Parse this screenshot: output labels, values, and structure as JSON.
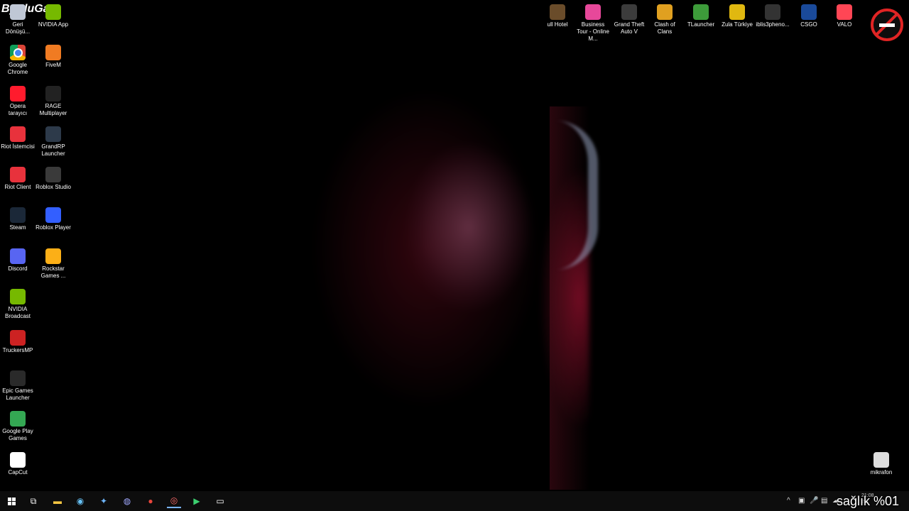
{
  "overlay": {
    "watermark": "ByBluGam",
    "status_text": "sağlık %01"
  },
  "desktop_left": [
    {
      "label": "Geri Dönüşü...",
      "icon": "recycle-bin-icon"
    },
    {
      "label": "NVIDIA App",
      "icon": "nvidia-icon"
    },
    {
      "label": "Google Chrome",
      "icon": "chrome-icon"
    },
    {
      "label": "FiveM",
      "icon": "fivem-icon"
    },
    {
      "label": "Opera tarayıcı",
      "icon": "opera-icon"
    },
    {
      "label": "RAGE Multiplayer",
      "icon": "rage-icon"
    },
    {
      "label": "Riot İstemcisi",
      "icon": "riot-icon"
    },
    {
      "label": "GrandRP Launcher",
      "icon": "grandrp-icon"
    },
    {
      "label": "Riot Client",
      "icon": "riot-client-icon"
    },
    {
      "label": "Roblox Studio",
      "icon": "roblox-studio-icon"
    },
    {
      "label": "Steam",
      "icon": "steam-icon"
    },
    {
      "label": "Roblox Player",
      "icon": "roblox-icon"
    },
    {
      "label": "Discord",
      "icon": "discord-icon"
    },
    {
      "label": "Rockstar Games ...",
      "icon": "rockstar-icon"
    },
    {
      "label": "NVIDIA Broadcast",
      "icon": "nvidia-broadcast-icon"
    },
    {
      "label": "TruckersMP",
      "icon": "truckersmp-icon"
    },
    {
      "label": "Epic Games Launcher",
      "icon": "epic-icon"
    },
    {
      "label": "Google Play Games",
      "icon": "google-play-icon"
    },
    {
      "label": "CapCut",
      "icon": "capcut-icon"
    }
  ],
  "desktop_top": [
    {
      "label": "ull Hotel",
      "icon": "hotel-icon"
    },
    {
      "label": "Business Tour - Online M...",
      "icon": "business-tour-icon"
    },
    {
      "label": "Grand Theft Auto V",
      "icon": "gta-icon"
    },
    {
      "label": "Clash of Clans",
      "icon": "clash-icon"
    },
    {
      "label": "TLauncher",
      "icon": "tlauncher-icon"
    },
    {
      "label": "Zula Türkiye",
      "icon": "zula-icon"
    },
    {
      "label": "iblis3pheno...",
      "icon": "iblis-icon"
    },
    {
      "label": "CSGO",
      "icon": "csgo-icon"
    },
    {
      "label": "VALO",
      "icon": "valorant-icon"
    }
  ],
  "desktop_right": {
    "label": "mikrafon",
    "icon": "microphone-icon"
  },
  "taskbar": {
    "glyphs": {
      "task_view": "⧉",
      "explorer": "▬",
      "steam": "◉",
      "copilot": "✦",
      "discord": "◍",
      "chrome": "●",
      "recorder": "◎",
      "launcher": "▶",
      "terminal": "▭"
    },
    "tray": {
      "chevron": "^",
      "icons": [
        "▣",
        "🎤",
        "▤",
        "☁"
      ]
    },
    "clock_time": "21:08",
    "clock_date": "26"
  }
}
